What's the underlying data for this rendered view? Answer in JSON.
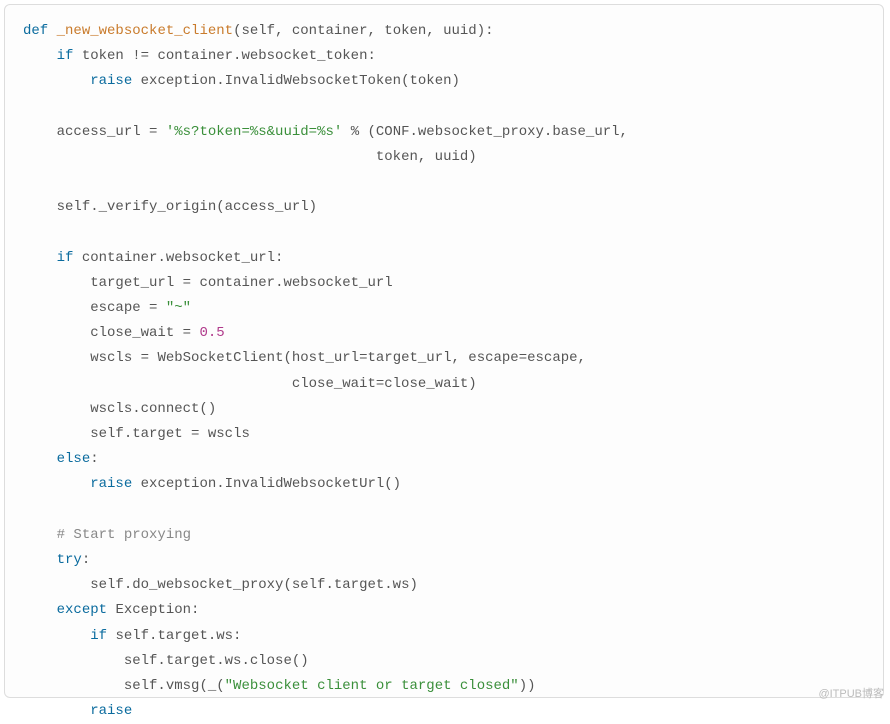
{
  "code": {
    "l1": {
      "kw": "def",
      "fn": "_new_websocket_client",
      "sig_open": "(self, container, token, uuid):"
    },
    "l2": {
      "kw": "if",
      "cond": "token != container.websocket_token:"
    },
    "l3": {
      "kw": "raise",
      "call": "exception.InvalidWebsocketToken(token)"
    },
    "l4": {
      "lhs": "access_url",
      "op": "=",
      "str": "'%s?token=%s&uuid=%s'",
      "pct": "%",
      "rest": "(CONF.websocket_proxy.base_url,"
    },
    "l5": {
      "rest": "token, uuid)"
    },
    "l6": {
      "call": "self._verify_origin(access_url)"
    },
    "l7": {
      "kw": "if",
      "cond": "container.websocket_url:"
    },
    "l8": {
      "lhs": "target_url",
      "op": "=",
      "rhs": "container.websocket_url"
    },
    "l9": {
      "lhs": "escape",
      "op": "=",
      "str": "\"~\""
    },
    "l10": {
      "lhs": "close_wait",
      "op": "=",
      "num": "0.5"
    },
    "l11": {
      "lhs": "wscls",
      "op": "=",
      "rhs": "WebSocketClient(host_url=target_url, escape=escape,"
    },
    "l12": {
      "rhs": "close_wait=close_wait)"
    },
    "l13": {
      "call": "wscls.connect()"
    },
    "l14": {
      "lhs": "self.target",
      "op": "=",
      "rhs": "wscls"
    },
    "l15": {
      "kw": "else",
      "colon": ":"
    },
    "l16": {
      "kw": "raise",
      "call": "exception.InvalidWebsocketUrl()"
    },
    "l17": {
      "cmt": "# Start proxying"
    },
    "l18": {
      "kw": "try",
      "colon": ":"
    },
    "l19": {
      "call": "self.do_websocket_proxy(self.target.ws)"
    },
    "l20": {
      "kw": "except",
      "rest": "Exception:"
    },
    "l21": {
      "kw": "if",
      "cond": "self.target.ws:"
    },
    "l22": {
      "call": "self.target.ws.close()"
    },
    "l23": {
      "pre": "self.vmsg(_(",
      "str": "\"Websocket client or target closed\"",
      "post": "))"
    },
    "l24": {
      "kw": "raise"
    }
  },
  "watermark": "@ITPUB博客"
}
